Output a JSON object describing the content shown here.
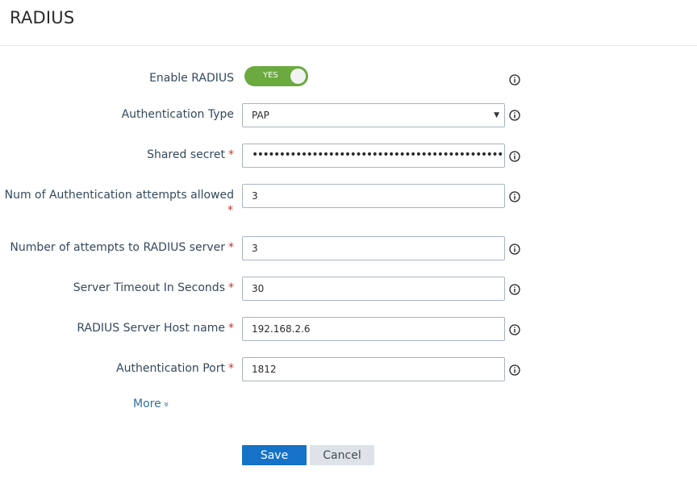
{
  "page": {
    "title": "RADIUS"
  },
  "form": {
    "enable_radius": {
      "label": "Enable RADIUS",
      "toggle_text": "YES",
      "enabled": true
    },
    "auth_type": {
      "label": "Authentication Type",
      "value": "PAP"
    },
    "shared_secret": {
      "label": "Shared secret",
      "required_mark": "*",
      "value": "••••••••••••••••••••••••••••••••••••••••••••••"
    },
    "auth_attempts": {
      "label": "Num of Authentication attempts allowed",
      "required_mark": "*",
      "value": "3"
    },
    "server_attempts": {
      "label": "Number of attempts to RADIUS server",
      "required_mark": "*",
      "value": "3"
    },
    "server_timeout": {
      "label": "Server Timeout In Seconds",
      "required_mark": "*",
      "value": "30"
    },
    "host_name": {
      "label": "RADIUS Server Host name",
      "required_mark": "*",
      "value": "192.168.2.6"
    },
    "auth_port": {
      "label": "Authentication Port",
      "required_mark": "*",
      "value": "1812"
    }
  },
  "more": {
    "label": "More",
    "icon": "double-chevron-down-icon"
  },
  "buttons": {
    "save": "Save",
    "cancel": "Cancel"
  },
  "colors": {
    "accent": "#1672c8",
    "toggle_on": "#6aaa3e",
    "required": "#c0392b",
    "label": "#34495e"
  }
}
